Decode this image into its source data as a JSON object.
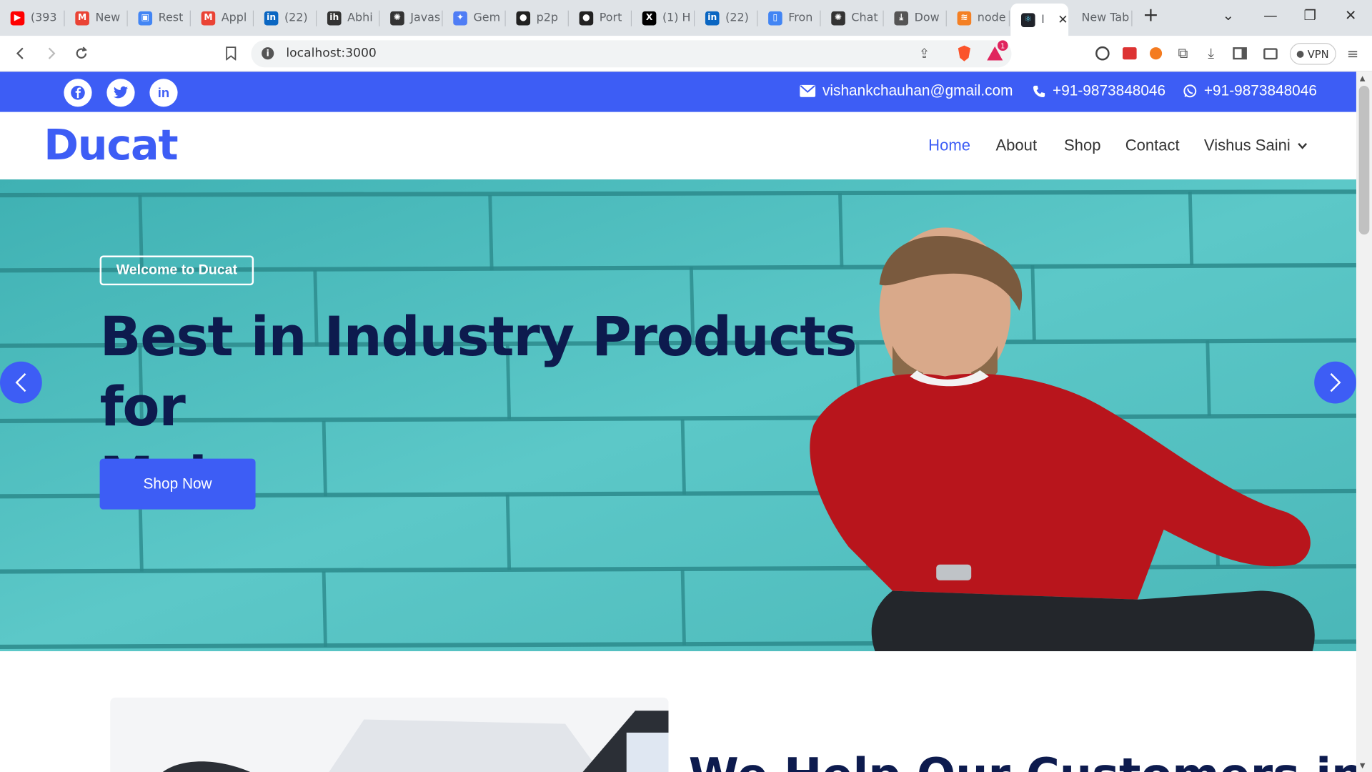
{
  "browser": {
    "tabs": [
      {
        "label": "(393",
        "icon": "youtube-icon",
        "color": "#ff0000"
      },
      {
        "label": "New",
        "icon": "gmail-icon",
        "color": "#ea4335"
      },
      {
        "label": "Rest",
        "icon": "app-icon",
        "color": "#4285f4"
      },
      {
        "label": "Appl",
        "icon": "gmail-icon",
        "color": "#ea4335"
      },
      {
        "label": "(22)",
        "icon": "linkedin-icon",
        "color": "#0a66c2"
      },
      {
        "label": "Abhi",
        "icon": "ih-icon",
        "color": "#333333"
      },
      {
        "label": "Javas",
        "icon": "openai-icon",
        "color": "#333333"
      },
      {
        "label": "Gem",
        "icon": "gemini-icon",
        "color": "#4f7df5"
      },
      {
        "label": "p2p",
        "icon": "github-icon",
        "color": "#222222"
      },
      {
        "label": "Port",
        "icon": "github-icon",
        "color": "#222222"
      },
      {
        "label": "(1) H",
        "icon": "x-icon",
        "color": "#000000"
      },
      {
        "label": "(22)",
        "icon": "linkedin-icon",
        "color": "#0a66c2"
      },
      {
        "label": "Fron",
        "icon": "doc-icon",
        "color": "#4285f4"
      },
      {
        "label": "Chat",
        "icon": "openai-icon",
        "color": "#333333"
      },
      {
        "label": "Dow",
        "icon": "download-icon",
        "color": "#555555"
      },
      {
        "label": "node",
        "icon": "stack-icon",
        "color": "#f48024"
      }
    ],
    "active_tab_label": "I",
    "new_tab_label": "New Tab",
    "url": "localhost:3000",
    "vpn_label": "VPN",
    "brave_badge": "1"
  },
  "site": {
    "topbar": {
      "email": "vishankchauhan@gmail.com",
      "phone": "+91-9873848046",
      "whatsapp": "+91-9873848046"
    },
    "logo": "Ducat",
    "nav": {
      "home": "Home",
      "about": "About",
      "shop": "Shop",
      "contact": "Contact",
      "user": "Vishus Saini"
    },
    "hero": {
      "badge": "Welcome to Ducat",
      "headline_line1": "Best in Industry Products for",
      "headline_line2": "Male",
      "cta": "Shop Now"
    },
    "section_title": "We Help Our Customers in G"
  },
  "colors": {
    "brand": "#3d5df5",
    "headline": "#0d1b4e",
    "hero_bg": "#4fb9b9"
  }
}
